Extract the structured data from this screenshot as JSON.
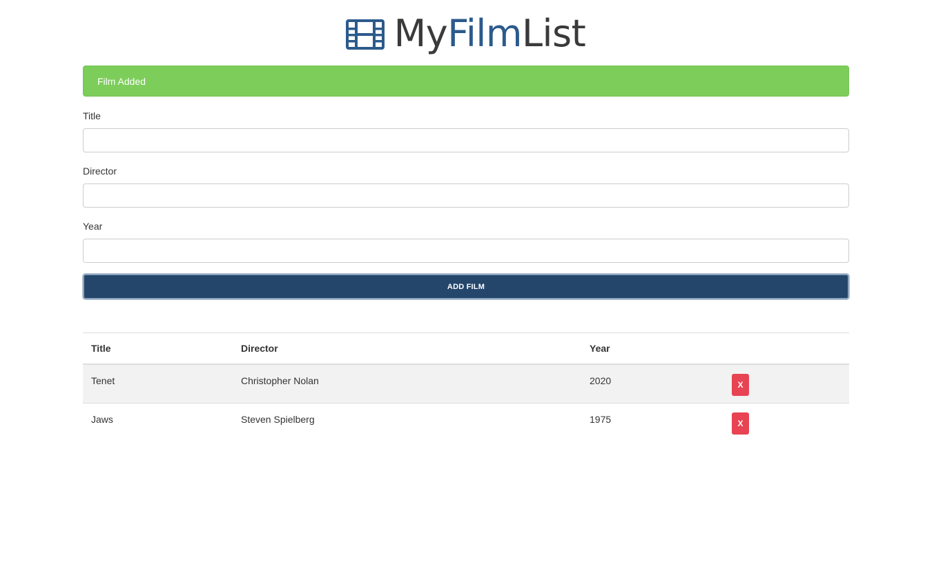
{
  "header": {
    "title_part1": "My",
    "title_part2": "Film",
    "title_part3": "List",
    "icon": "film-icon",
    "accent_color": "#2c5a8c"
  },
  "alert": {
    "message": "Film Added",
    "color": "#7dcd5b"
  },
  "form": {
    "fields": [
      {
        "label": "Title",
        "value": "",
        "placeholder": ""
      },
      {
        "label": "Director",
        "value": "",
        "placeholder": ""
      },
      {
        "label": "Year",
        "value": "",
        "placeholder": ""
      }
    ],
    "submit_label": "ADD FILM",
    "submit_color": "#24466b"
  },
  "table": {
    "headers": [
      "Title",
      "Director",
      "Year",
      ""
    ],
    "rows": [
      {
        "title": "Tenet",
        "director": "Christopher Nolan",
        "year": "2020",
        "delete_label": "X"
      },
      {
        "title": "Jaws",
        "director": "Steven Spielberg",
        "year": "1975",
        "delete_label": "X"
      }
    ],
    "delete_color": "#e74352"
  }
}
